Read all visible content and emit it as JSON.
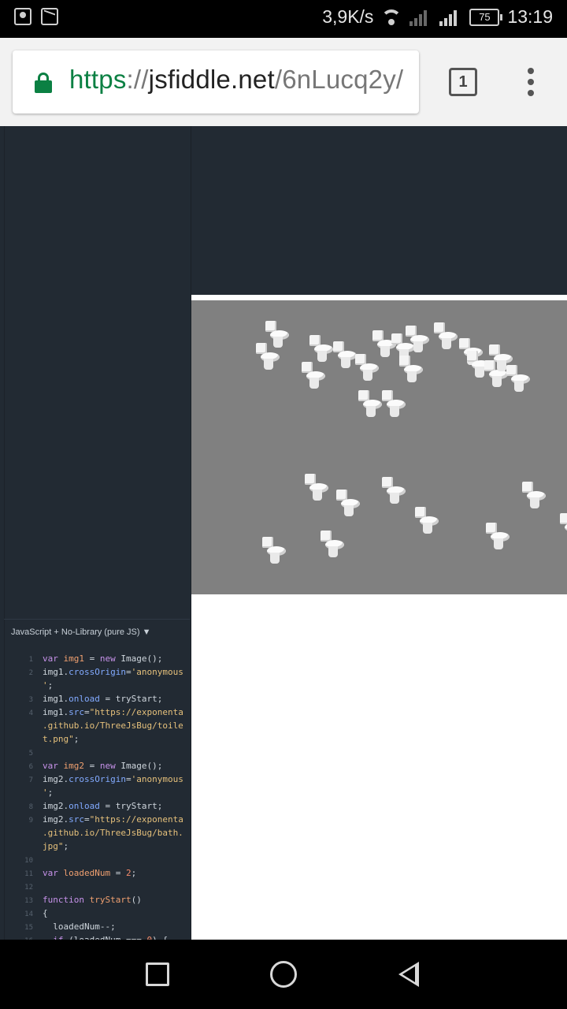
{
  "status_bar": {
    "net_speed": "3,9K/s",
    "battery": "75",
    "time": "13:19"
  },
  "browser": {
    "url_scheme": "https",
    "url_sep": "://",
    "url_host": "jsfiddle.net",
    "url_path": "/6nLucq2y/",
    "tab_count": "1"
  },
  "editor": {
    "language_label": "JavaScript + No-Library (pure JS) ▼"
  }
}
